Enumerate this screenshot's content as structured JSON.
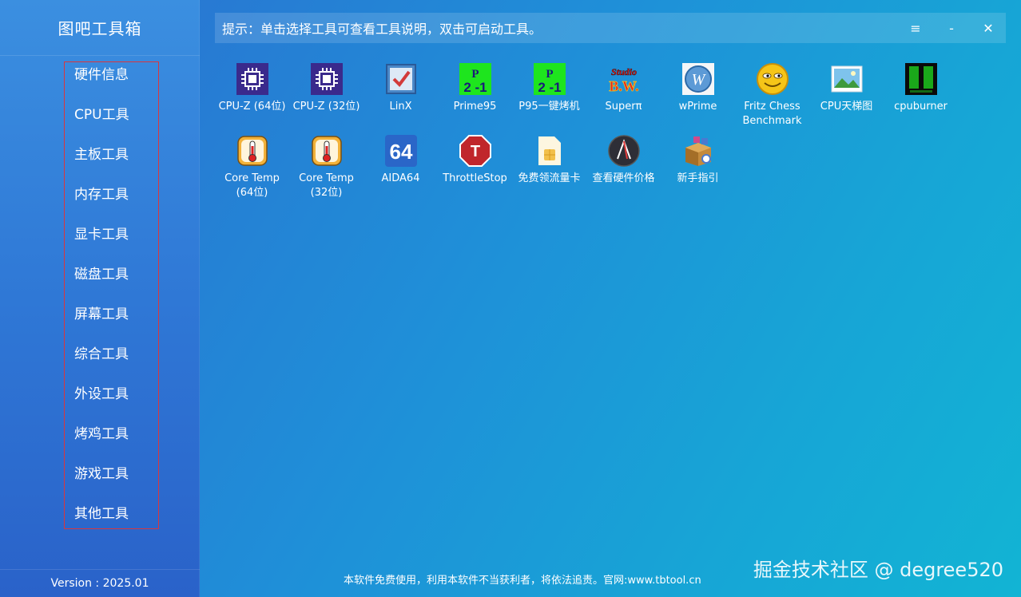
{
  "app": {
    "title": "图吧工具箱",
    "version": "Version : 2025.01"
  },
  "sidebar": {
    "items": [
      {
        "label": "硬件信息"
      },
      {
        "label": "CPU工具"
      },
      {
        "label": "主板工具"
      },
      {
        "label": "内存工具"
      },
      {
        "label": "显卡工具"
      },
      {
        "label": "磁盘工具"
      },
      {
        "label": "屏幕工具"
      },
      {
        "label": "综合工具"
      },
      {
        "label": "外设工具"
      },
      {
        "label": "烤鸡工具"
      },
      {
        "label": "游戏工具"
      },
      {
        "label": "其他工具"
      }
    ]
  },
  "hint": "提示：单击选择工具可查看工具说明，双击可启动工具。",
  "window_buttons": {
    "menu": "≡",
    "minimize": "-",
    "close": "✕"
  },
  "tools": [
    {
      "label": "CPU-Z (64位)",
      "icon": "cpuz-icon"
    },
    {
      "label": "CPU-Z (32位)",
      "icon": "cpuz-icon"
    },
    {
      "label": "LinX",
      "icon": "linx-icon"
    },
    {
      "label": "Prime95",
      "icon": "prime95-icon"
    },
    {
      "label": "P95一键烤机",
      "icon": "prime95-icon"
    },
    {
      "label": "Superπ",
      "icon": "superpi-icon"
    },
    {
      "label": "wPrime",
      "icon": "wprime-icon"
    },
    {
      "label": "Fritz Chess\nBenchmark",
      "icon": "fritz-smiley-icon"
    },
    {
      "label": "CPU天梯图",
      "icon": "landscape-image-icon"
    },
    {
      "label": "cpuburner",
      "icon": "cpuburner-icon"
    },
    {
      "label": "Core Temp\n(64位)",
      "icon": "thermometer-icon"
    },
    {
      "label": "Core Temp\n(32位)",
      "icon": "thermometer-icon"
    },
    {
      "label": "AIDA64",
      "icon": "aida64-icon"
    },
    {
      "label": "ThrottleStop",
      "icon": "throttlestop-icon"
    },
    {
      "label": "免费领流量卡",
      "icon": "sim-card-icon"
    },
    {
      "label": "查看硬件价格",
      "icon": "price-icon"
    },
    {
      "label": "新手指引",
      "icon": "guide-box-icon"
    }
  ],
  "prime_glyph": {
    "top": "P",
    "bottom": "2 -1"
  },
  "superpi_glyph": {
    "top": "Studio",
    "bottom": "B.W."
  },
  "aida_glyph": "64",
  "throttle_glyph": "T",
  "footer": "本软件免费使用，利用本软件不当获利者，将依法追责。官网:www.tbtool.cn",
  "watermark": "掘金技术社区 @ degree520"
}
